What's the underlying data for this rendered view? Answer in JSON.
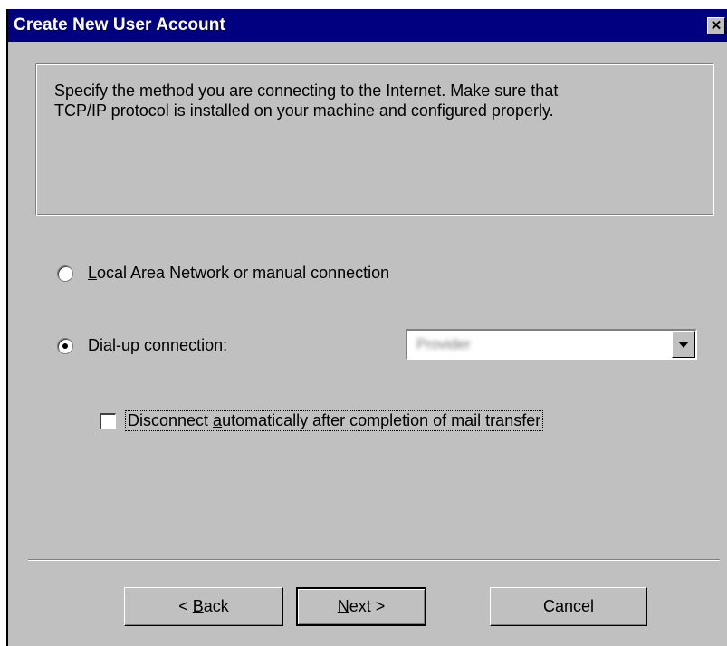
{
  "window": {
    "title": "Create New User Account",
    "close_glyph": "✕"
  },
  "info": {
    "line1": "Specify the method you are connecting to the Internet. Make sure that",
    "line2": "TCP/IP protocol is installed on your machine and configured properly."
  },
  "options": {
    "lan": {
      "access_key": "L",
      "rest": "ocal Area Network or manual connection",
      "selected": false
    },
    "dialup": {
      "access_key": "D",
      "rest": "ial-up connection:",
      "selected": true
    }
  },
  "dialup_combo": {
    "value": "Provider",
    "icon": "dropdown-arrow-icon"
  },
  "auto_disconnect": {
    "checked": false,
    "before": "Disconnect ",
    "access_key": "a",
    "after": "utomatically after completion of mail transfer"
  },
  "buttons": {
    "back": {
      "prefix": "< ",
      "access_key": "B",
      "rest": "ack"
    },
    "next": {
      "access_key": "N",
      "rest": "ext",
      "suffix": " >"
    },
    "cancel": {
      "label": "Cancel"
    }
  }
}
